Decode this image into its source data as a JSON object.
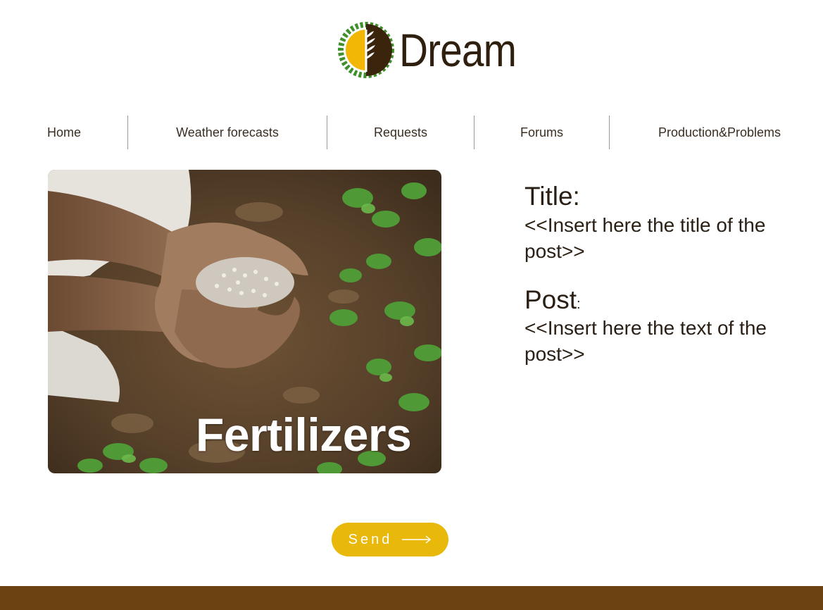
{
  "brand": {
    "name": "Dream",
    "logo_icon": "wheat-leaf-logo-icon",
    "colors": {
      "dark_brown": "#2f1f0e",
      "gold": "#e8b90a",
      "green": "#3a8a2a"
    }
  },
  "nav": {
    "items": [
      {
        "label": "Home"
      },
      {
        "label": "Weather forecasts"
      },
      {
        "label": "Requests"
      },
      {
        "label": "Forums"
      },
      {
        "label": "Production&Problems"
      }
    ]
  },
  "hero": {
    "caption": "Fertilizers"
  },
  "post": {
    "title_label": "Title:",
    "title_placeholder": "<<Insert here the title of the post>>",
    "post_label": "Post",
    "post_colon": ":",
    "post_placeholder": "<<Insert here the text of the post>>"
  },
  "send_button": {
    "label": "Send",
    "icon": "long-arrow-right-icon"
  },
  "footer": {
    "color": "#6b4210"
  }
}
